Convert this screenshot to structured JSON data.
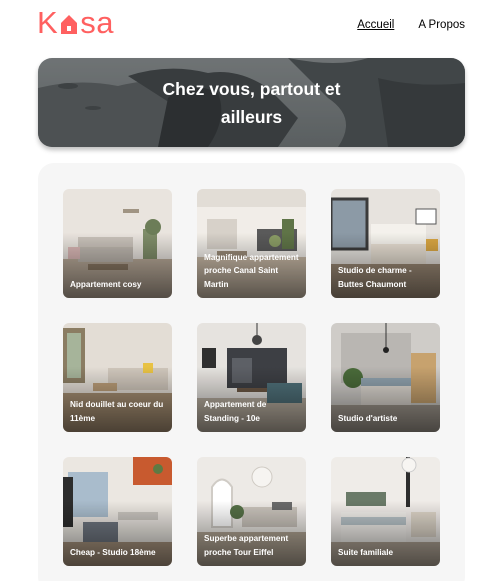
{
  "brand": {
    "logo_text_left": "K",
    "logo_text_right": "sa",
    "accent_color": "#ff6060"
  },
  "nav": {
    "items": [
      {
        "label": "Accueil",
        "active": true
      },
      {
        "label": "A Propos",
        "active": false
      }
    ]
  },
  "banner": {
    "title": "Chez vous, partout et ailleurs"
  },
  "gallery": {
    "cards": [
      {
        "title": "Appartement cosy"
      },
      {
        "title": "Magnifique appartement proche Canal Saint Martin"
      },
      {
        "title": "Studio de charme - Buttes Chaumont"
      },
      {
        "title": "Nid douillet au coeur du 11ème"
      },
      {
        "title": "Appartement de Standing - 10e"
      },
      {
        "title": "Studio d'artiste"
      },
      {
        "title": "Cheap - Studio 18ème"
      },
      {
        "title": "Superbe appartement proche Tour Eiffel"
      },
      {
        "title": "Suite familiale"
      }
    ]
  }
}
